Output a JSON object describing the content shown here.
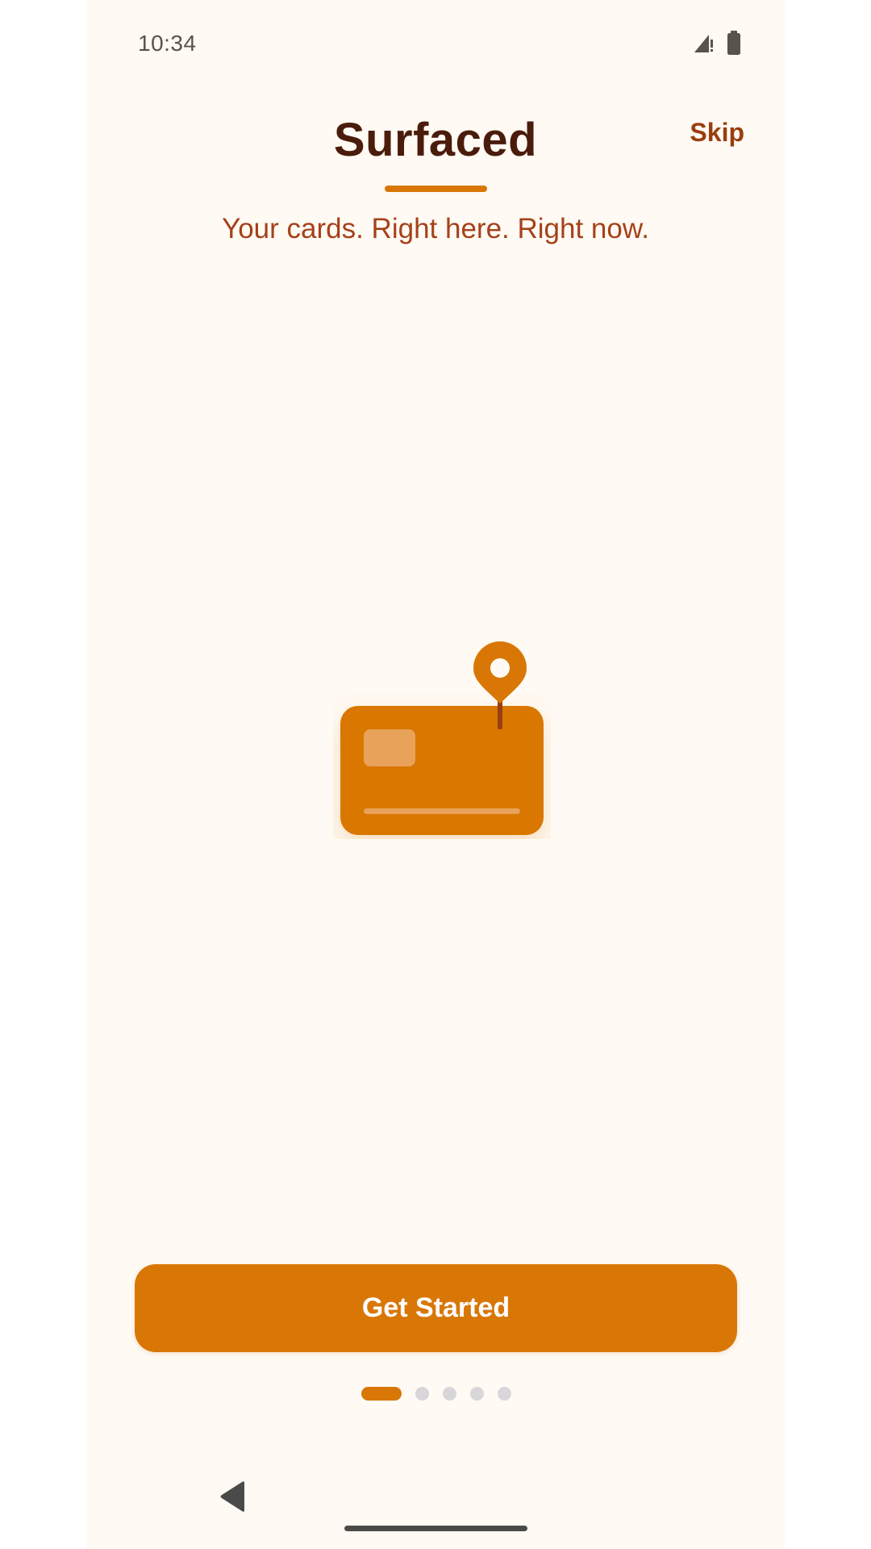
{
  "status_bar": {
    "time": "10:34",
    "icons": [
      "signal-icon",
      "battery-icon"
    ]
  },
  "header": {
    "title": "Surfaced",
    "skip_label": "Skip",
    "tagline": "Your cards. Right here. Right now."
  },
  "illustration": {
    "icon": "card-with-location-pin-icon"
  },
  "cta": {
    "label": "Get Started"
  },
  "pager": {
    "page_count": 5,
    "current_page": 1
  },
  "nav_bar": {
    "icons": [
      "back-icon",
      "home-indicator"
    ]
  },
  "colors": {
    "background": "#fffaf3",
    "accent": "#d97706",
    "title": "#4a1c0c",
    "tagline": "#a5411a",
    "skip": "#9a3e10",
    "inactive_dot": "#d9d6da"
  }
}
